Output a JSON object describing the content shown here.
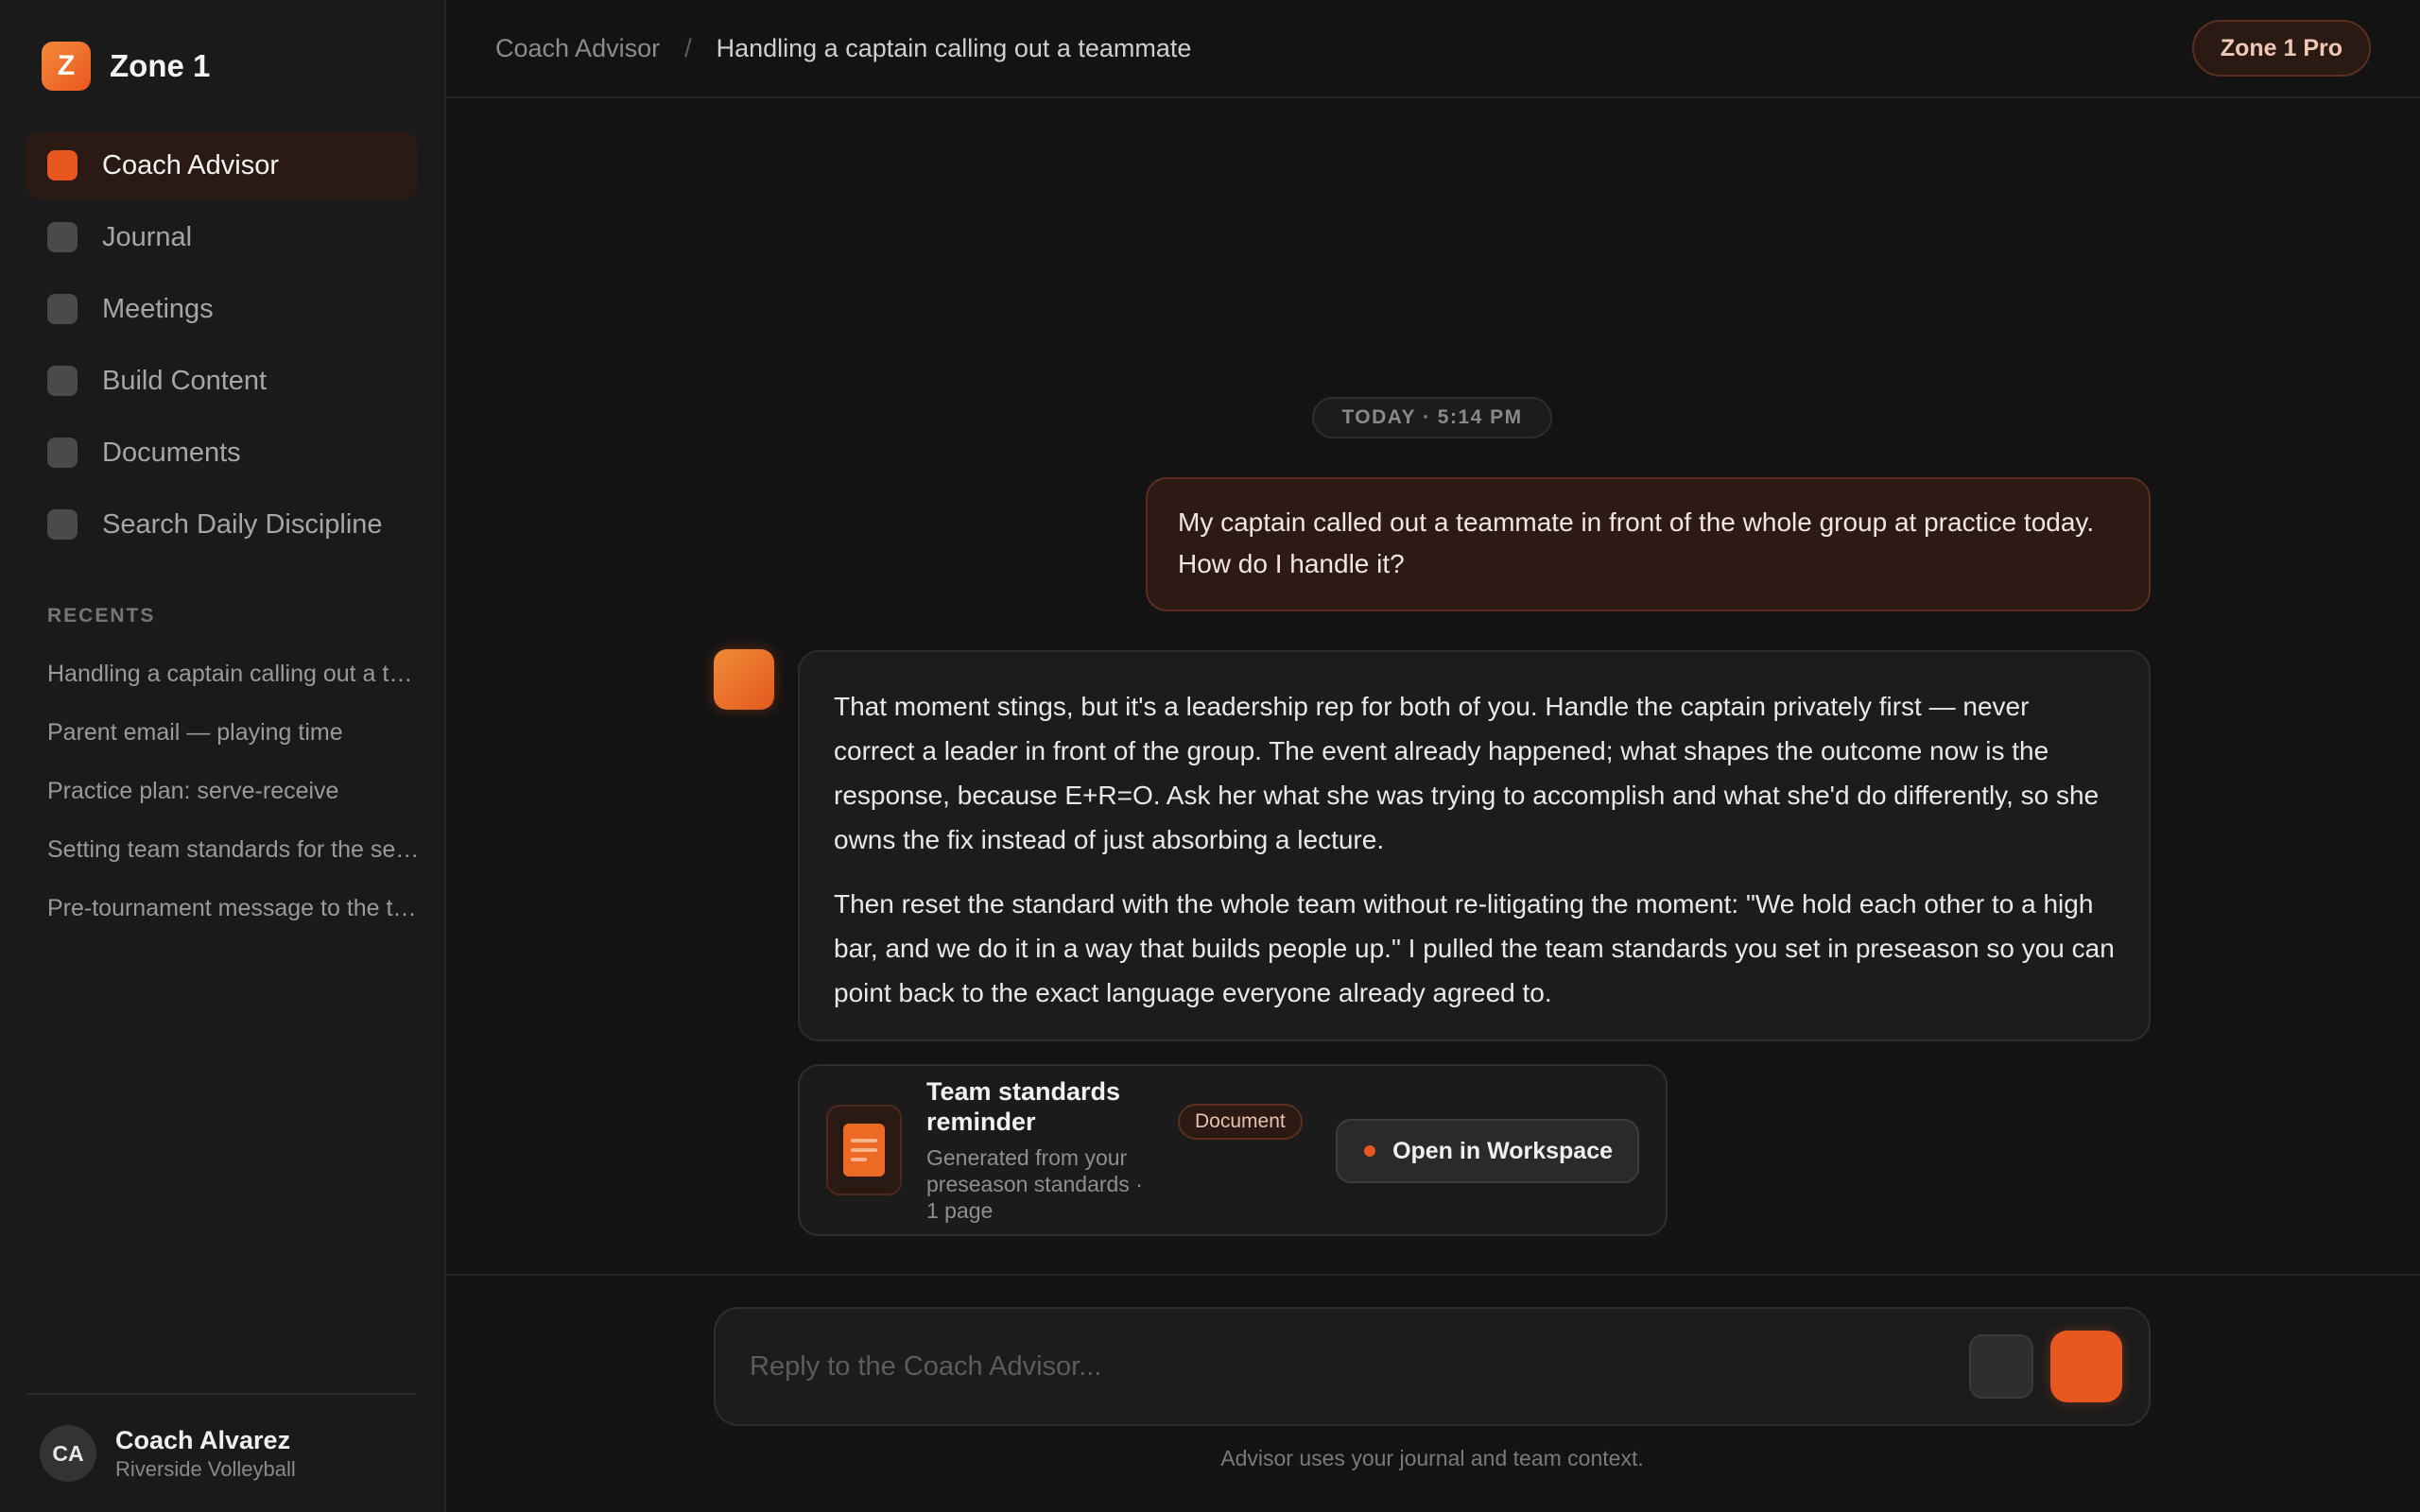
{
  "brand": {
    "logo_letter": "Z",
    "name": "Zone 1"
  },
  "nav": [
    {
      "label": "Coach Advisor",
      "active": true
    },
    {
      "label": "Journal"
    },
    {
      "label": "Meetings"
    },
    {
      "label": "Build Content"
    },
    {
      "label": "Documents"
    },
    {
      "label": "Search Daily Discipline"
    }
  ],
  "recents": {
    "title": "RECENTS",
    "items": [
      "Handling a captain calling out a teammate",
      "Parent email — playing time",
      "Practice plan: serve-receive",
      "Setting team standards for the season",
      "Pre-tournament message to the team"
    ]
  },
  "user": {
    "initials": "CA",
    "name": "Coach Alvarez",
    "team": "Riverside Volleyball"
  },
  "header": {
    "crumb_root": "Coach Advisor",
    "separator": "/",
    "crumb_current": "Handling a captain calling out a teammate",
    "badge": "Zone 1 Pro"
  },
  "chat": {
    "timestamp": "TODAY · 5:14 PM",
    "user_message": "My captain called out a teammate in front of the whole group at practice today. How do I handle it?",
    "assistant_paragraphs": [
      "That moment stings, but it's a leadership rep for both of you. Handle the captain privately first — never correct a leader in front of the group. The event already happened; what shapes the outcome now is the response, because E+R=O. Ask her what she was trying to accomplish and what she'd do differently, so she owns the fix instead of just absorbing a lecture.",
      "Then reset the standard with the whole team without re-litigating the moment: \"We hold each other to a high bar, and we do it in a way that builds people up.\" I pulled the team standards you set in preseason so you can point back to the exact language everyone already agreed to."
    ],
    "document": {
      "title": "Team standards reminder",
      "tag": "Document",
      "subtitle": "Generated from your preseason standards · 1 page",
      "open_label": "Open in Workspace"
    }
  },
  "composer": {
    "placeholder": "Reply to the Coach Advisor...",
    "footer_note": "Advisor uses your journal and team context."
  },
  "colors": {
    "accent": "#e8571f",
    "background": "#131313",
    "sidebar": "#1a1a1a"
  }
}
